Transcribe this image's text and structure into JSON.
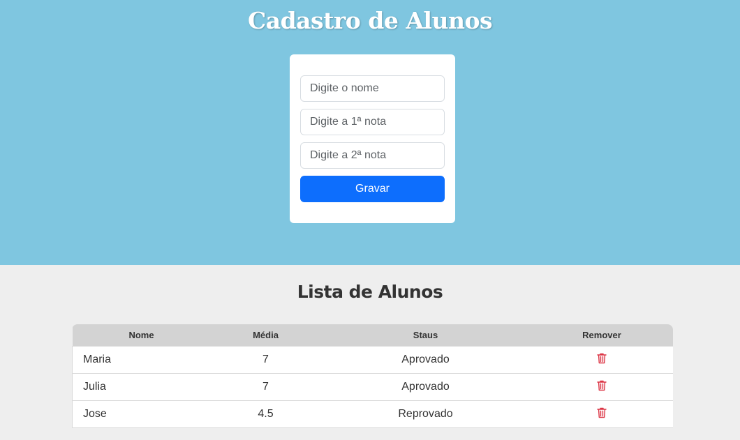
{
  "header": {
    "title": "Cadastro de Alunos"
  },
  "form": {
    "name_placeholder": "Digite o nome",
    "grade1_placeholder": "Digite a 1ª nota",
    "grade2_placeholder": "Digite a 2ª nota",
    "submit_label": "Gravar"
  },
  "list": {
    "title": "Lista de Alunos",
    "columns": [
      "Nome",
      "Média",
      "Staus",
      "Remover"
    ],
    "rows": [
      {
        "nome": "Maria",
        "media": "7",
        "status": "Aprovado",
        "remove_icon": "trash-icon"
      },
      {
        "nome": "Julia",
        "media": "7",
        "status": "Aprovado",
        "remove_icon": "trash-icon"
      },
      {
        "nome": "Jose",
        "media": "4.5",
        "status": "Reprovado",
        "remove_icon": "trash-icon"
      }
    ]
  },
  "colors": {
    "header_bg": "#7fc6e0",
    "body_bg": "#eeeeee",
    "primary_button": "#0d6efd",
    "table_header_bg": "#d3d3d3",
    "trash_icon": "#dc3545"
  }
}
